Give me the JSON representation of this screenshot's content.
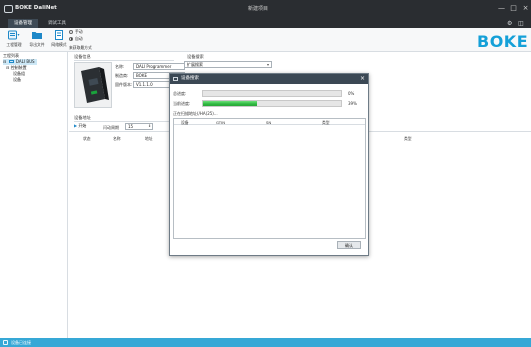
{
  "window": {
    "app_title": "BOKE DaliNet",
    "center_title": "新建项目",
    "controls": {
      "minimize": "—",
      "maximize": "□",
      "close": "×"
    }
  },
  "menubar": {
    "tabs": [
      {
        "label": "设备管理",
        "active": true
      },
      {
        "label": "调试工具",
        "active": false
      }
    ]
  },
  "toolbar": {
    "buttons": [
      {
        "label": "工程管理",
        "icon": "project-icon"
      },
      {
        "label": "导出文件",
        "icon": "folder-icon"
      },
      {
        "label": "网络模式",
        "icon": "network-icon"
      }
    ],
    "radio_manual": "手动",
    "radio_auto": "自动",
    "mode_label": "来获取最方式",
    "brand": "BOKE",
    "brand_color": "#14a0d8"
  },
  "tree": {
    "header": "工程列表",
    "items": [
      {
        "label": "DALI BUS",
        "selected": true
      },
      {
        "label": "控制装置",
        "selected": false
      },
      {
        "label": "设备组",
        "selected": false
      },
      {
        "label": "设备",
        "selected": false
      }
    ]
  },
  "device_info": {
    "title": "设备信息",
    "name_label": "名称:",
    "name_value": "DALI Programmer",
    "vendor_label": "制造商:",
    "vendor_value": "BOKE",
    "fw_label": "固件版本:",
    "fw_value": "V1.1.1.0"
  },
  "device_search": {
    "title": "设备搜索",
    "select_value": "扩展搜索"
  },
  "device_addr": {
    "title": "设备地址",
    "start_label": "开始",
    "freq_label": "闪动周期",
    "freq_value": "15",
    "columns": [
      "状态",
      "名称",
      "地址"
    ],
    "columns_right": [
      "类型"
    ]
  },
  "dialog": {
    "title": "设备搜索",
    "close": "×",
    "progress_label_1": "总进度:",
    "progress_1": 0,
    "progress_1_text": "0%",
    "progress_label_2": "当前进度:",
    "progress_2": 39,
    "progress_2_text": "39%",
    "status_text": "正在扫描地址(/HA(25)...",
    "columns": [
      "设备",
      "GTIN",
      "SN",
      "类型"
    ],
    "ok_label": "确认"
  },
  "statusbar": {
    "text": "设备已连接"
  }
}
